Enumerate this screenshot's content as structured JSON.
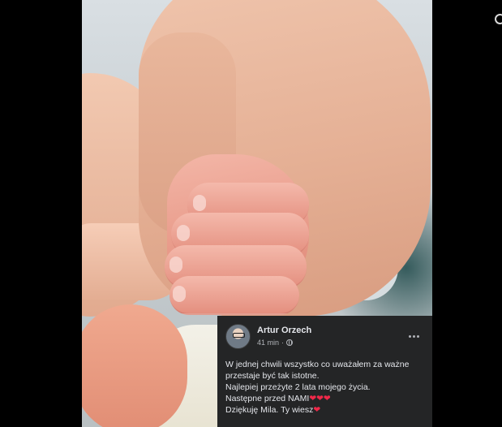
{
  "post": {
    "author": "Artur Orzech",
    "time": "41 min",
    "separator": "·",
    "privacy_icon": "globe-icon",
    "more_icon": "more-horizontal-icon",
    "lines": [
      {
        "text": "W jednej chwili wszystko co uważałem za ważne",
        "hearts": ""
      },
      {
        "text": "przestaje być tak istotne.",
        "hearts": ""
      },
      {
        "text": "Najlepiej przeżyte 2 lata mojego życia.",
        "hearts": ""
      },
      {
        "text": "Następne przed NAMI",
        "hearts": "❤❤❤"
      },
      {
        "text": "Dziękuję Mila. Ty wiesz",
        "hearts": "❤"
      }
    ]
  },
  "photo": {
    "subject_icon": "photo-image"
  },
  "colors": {
    "post_background": "#242526",
    "post_text": "#e4e6eb",
    "secondary_text": "#b0b3b8",
    "heart": "#f02849",
    "page_background": "#000000"
  }
}
